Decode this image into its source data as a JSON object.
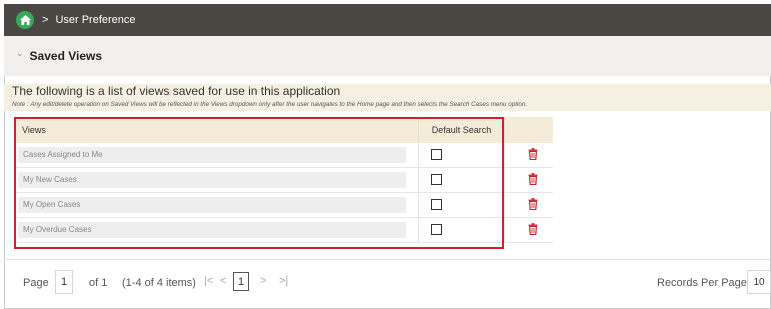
{
  "breadcrumb": {
    "current": "User Preference"
  },
  "section": {
    "title": "Saved Views"
  },
  "info": {
    "main": "The following is a list of views saved for use in this application",
    "note": "Note : Any edit/delete operation on Saved Views will be reflected in the Views dropdown only after the user navigates to the Home page and then selects the Search Cases menu option."
  },
  "table": {
    "headers": {
      "views": "Views",
      "default_search": "Default Search"
    },
    "rows": [
      {
        "name": "Cases Assigned to Me",
        "default": false
      },
      {
        "name": "My New Cases",
        "default": false
      },
      {
        "name": "My Open Cases",
        "default": false
      },
      {
        "name": "My Overdue Cases",
        "default": false
      }
    ]
  },
  "pagination": {
    "page_label": "Page",
    "page_value": "1",
    "of_label": "of 1",
    "items_label": "(1-4 of 4 items)",
    "first": "|<",
    "prev": "<",
    "current": "1",
    "next": ">",
    "last": ">|",
    "records_label": "Records Per Page",
    "records_value": "10"
  },
  "colors": {
    "topbar": "#4a4642",
    "home": "#3aa85c",
    "header": "#f4ecd8",
    "highlight": "#d11f2c",
    "delete": "#d11f2c"
  }
}
